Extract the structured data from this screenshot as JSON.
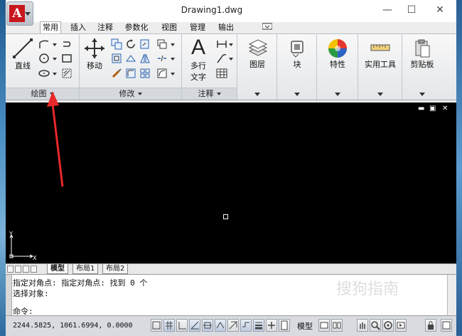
{
  "window": {
    "title": "Drawing1.dwg",
    "minimize": "—",
    "maximize": "☐",
    "close": "✕"
  },
  "app_button": {
    "letter": "A"
  },
  "ribbon_tabs": [
    "常用",
    "插入",
    "注释",
    "参数化",
    "视图",
    "管理",
    "输出"
  ],
  "ribbon": {
    "draw": {
      "line_label": "直线",
      "panel_label": "绘图"
    },
    "modify": {
      "move_label": "移动",
      "panel_label": "修改"
    },
    "annotate": {
      "text_label_1": "多行",
      "text_label_2": "文字",
      "panel_label": "注释",
      "big_letter": "A"
    },
    "layers": {
      "label": "图层"
    },
    "block": {
      "label": "块"
    },
    "properties": {
      "label": "特性"
    },
    "utilities": {
      "label": "实用工具"
    },
    "clipboard": {
      "label": "剪贴板"
    }
  },
  "viewport": {
    "minimize": "▬",
    "restore": "▣",
    "close": "✕"
  },
  "ucs": {
    "x": "X",
    "y": "Y"
  },
  "layout_tabs": [
    "模型",
    "布局1",
    "布局2"
  ],
  "command": {
    "line1": "指定对角点: 指定对角点: 找到 0 个",
    "line2": "选择对象:",
    "prompt": "命令:"
  },
  "status": {
    "coordinates": "2244.5825,  1061.6994, 0.0000",
    "model_label": "模型"
  },
  "colors": {
    "annotation_arrow": "#e8282b",
    "app_red": "#c9171e"
  },
  "watermark": "搜狗指南"
}
